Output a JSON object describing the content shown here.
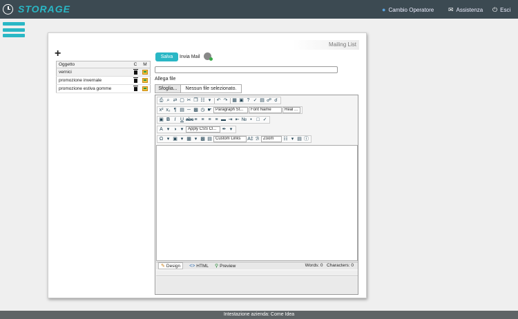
{
  "app": {
    "title": "STORAGE"
  },
  "topbar": {
    "cambio_operatore": "Cambio Operatore",
    "assistenza": "Assistenza",
    "esci": "Esci"
  },
  "card": {
    "tab_title": "Mailing List"
  },
  "list": {
    "headers": {
      "oggetto": "Oggetto",
      "c": "C",
      "m": "M"
    },
    "rows": [
      {
        "name": "vernici"
      },
      {
        "name": "promozione invernale"
      },
      {
        "name": "promozione estiva gomme"
      }
    ]
  },
  "form": {
    "salva": "Salva",
    "invia": "Invia Mail",
    "allega_label": "Allega file",
    "sfoglia": "Sfoglia...",
    "nofile": "Nessun file selezionato."
  },
  "editor": {
    "paragraph_style": "Paragraph St...",
    "font_name": "Font Name",
    "real_font": "Real ...",
    "apply_css": "Apply CSS Cl...",
    "custom_links": "Custom Links",
    "zoom": "Zoom",
    "modes": {
      "design": "Design",
      "html": "HTML",
      "preview": "Preview"
    },
    "words": "Words: 0",
    "characters": "Characters: 0"
  },
  "footer": {
    "text": "Intestazione azienda: Come Idea"
  }
}
